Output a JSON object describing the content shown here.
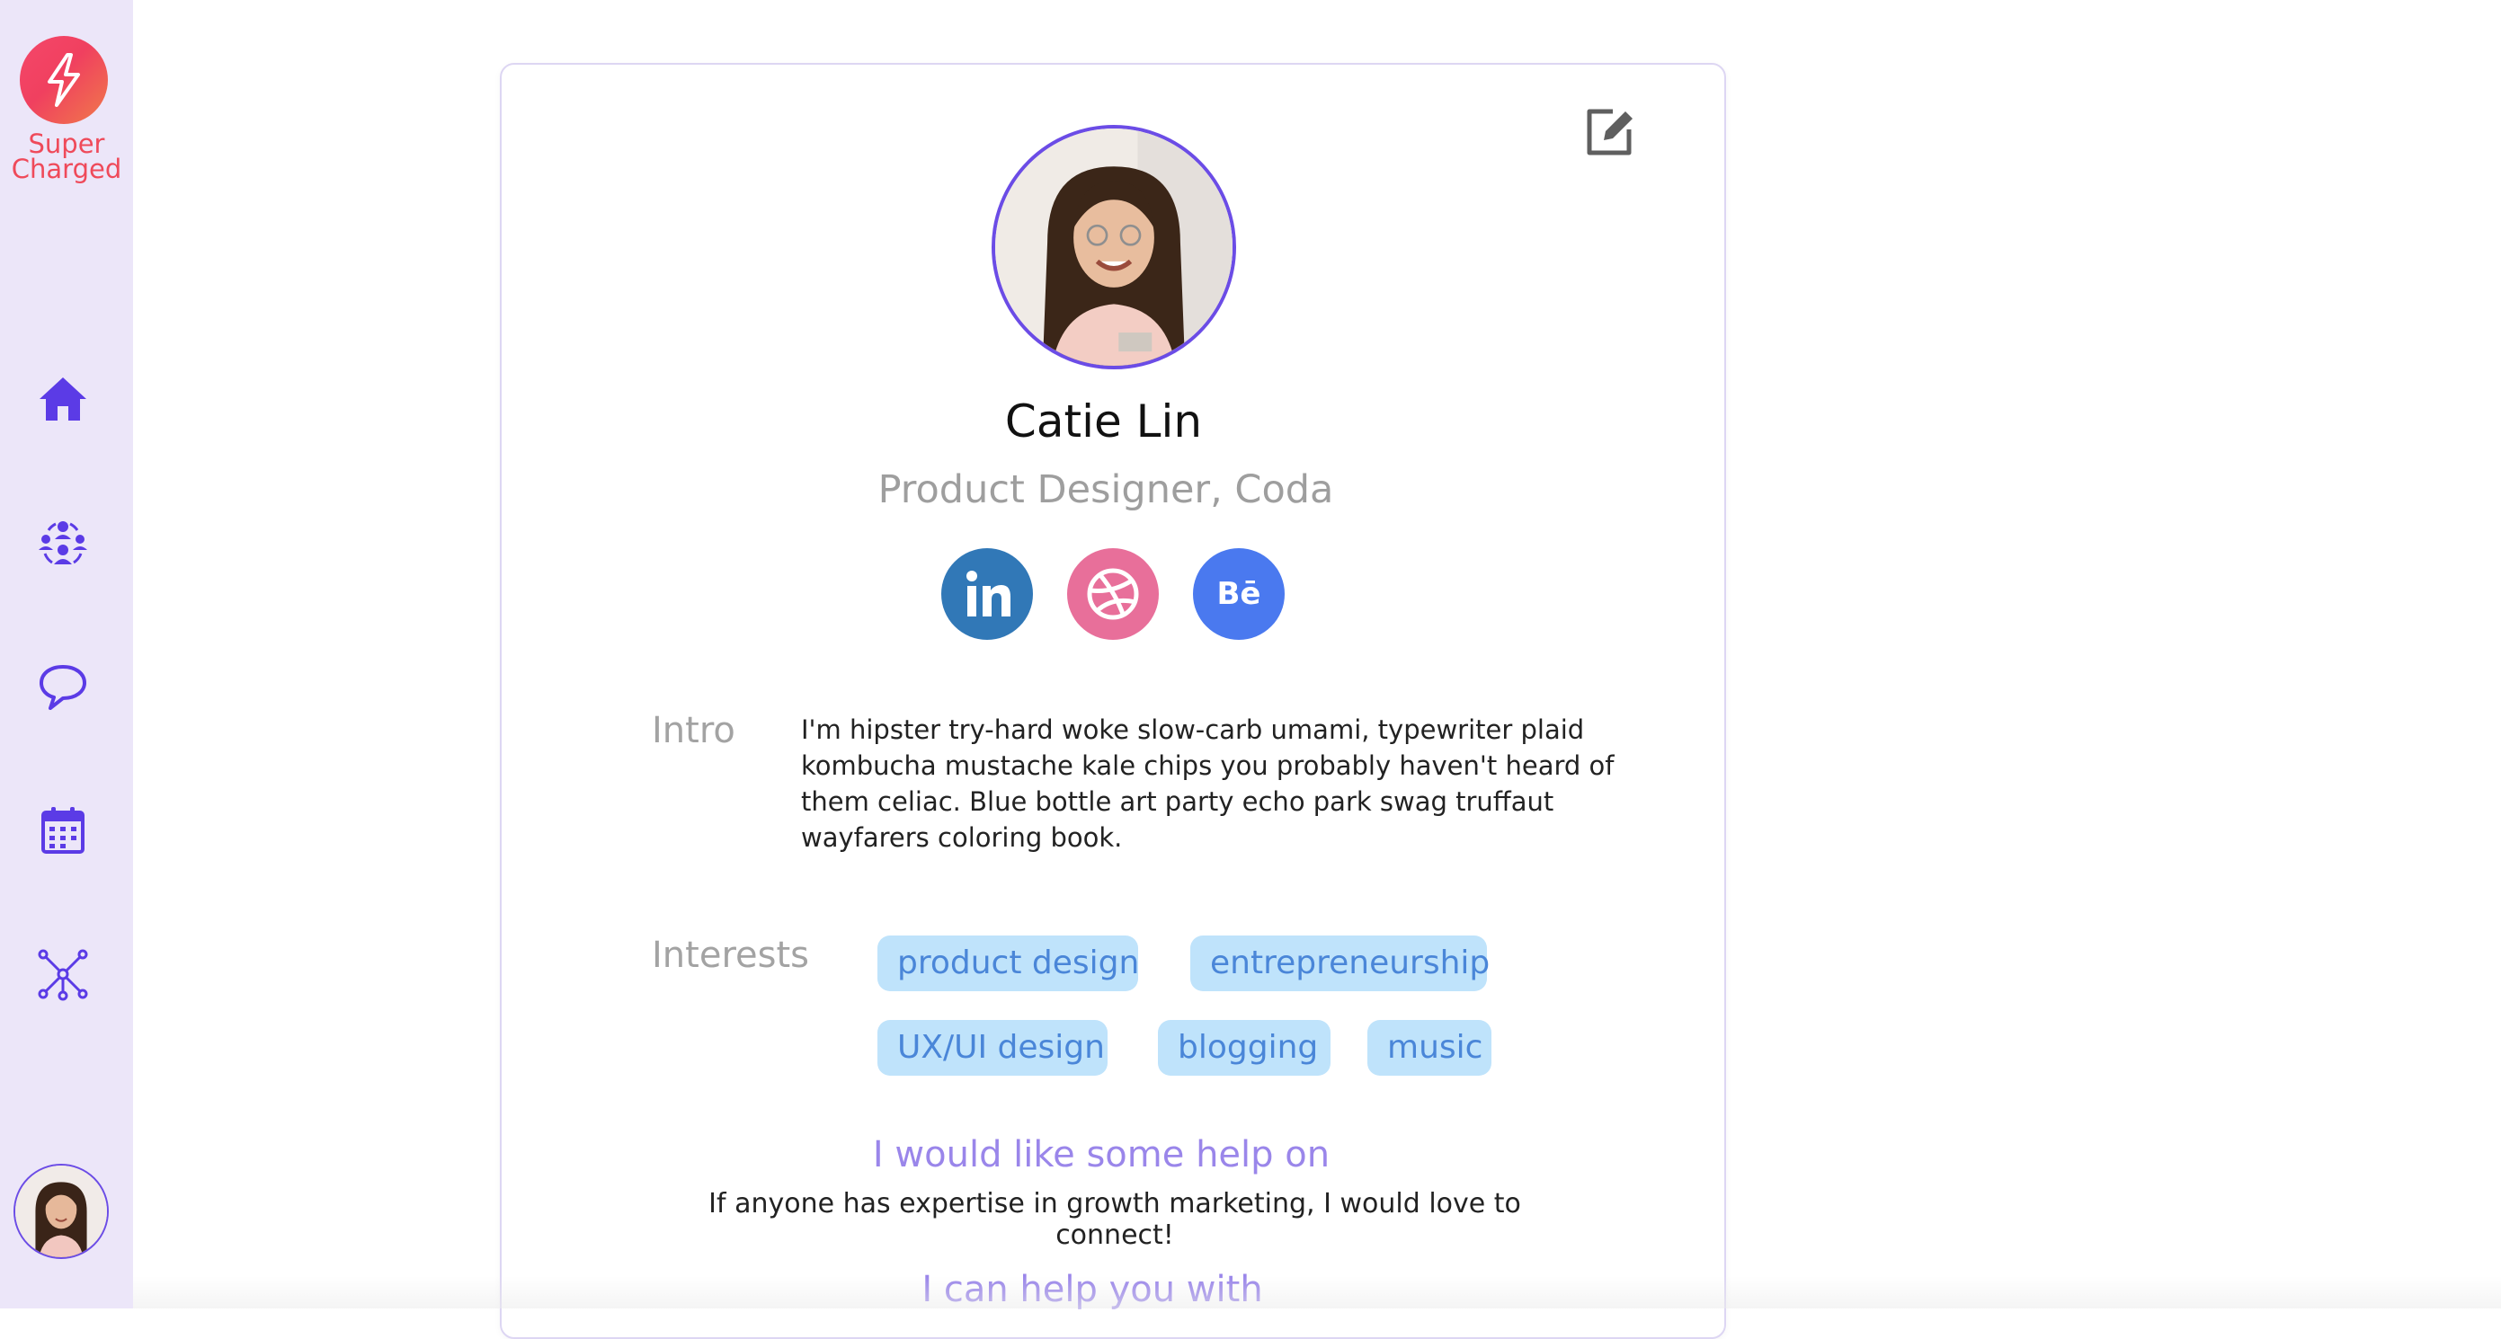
{
  "brand": {
    "logo_icon": "lightning-bolt-icon",
    "name_line1": "Super",
    "name_line2": "Charged",
    "logo_color": "#ef4a5a"
  },
  "sidebar": {
    "items": [
      {
        "id": "home",
        "icon": "home-icon"
      },
      {
        "id": "community",
        "icon": "community-icon"
      },
      {
        "id": "chat",
        "icon": "chat-bubble-icon"
      },
      {
        "id": "calendar",
        "icon": "calendar-icon"
      },
      {
        "id": "network",
        "icon": "network-icon"
      }
    ],
    "accent": "#5b3be6",
    "background": "#ece6f9"
  },
  "profile": {
    "name": "Catie Lin",
    "role": "Product Designer, Coda",
    "edit_icon": "edit-icon",
    "socials": [
      {
        "name": "LinkedIn",
        "icon": "linkedin-icon",
        "color": "#3178b7"
      },
      {
        "name": "Dribbble",
        "icon": "dribbble-icon",
        "color": "#e86f9a"
      },
      {
        "name": "Behance",
        "icon": "behance-icon",
        "color": "#4a79ef"
      }
    ],
    "intro_label": "Intro",
    "intro_text": "I'm hipster try-hard woke slow-carb umami, typewriter plaid kombucha mustache kale chips you probably haven't heard of them celiac. Blue bottle art party echo park swag truffaut wayfarers coloring book.",
    "interests_label": "Interests",
    "interests": [
      "product design",
      "entrepreneurship",
      "UX/UI design",
      "blogging",
      "music"
    ],
    "help_on_title": "I would like some help on",
    "help_on_text": "If anyone has expertise in growth marketing, I would love to connect!",
    "can_help_title": "I can help you with"
  },
  "colors": {
    "tag_bg": "#bfe3fb",
    "tag_text": "#4a86d8",
    "section_title": "#9a86ea",
    "muted": "#a3a3a3"
  }
}
